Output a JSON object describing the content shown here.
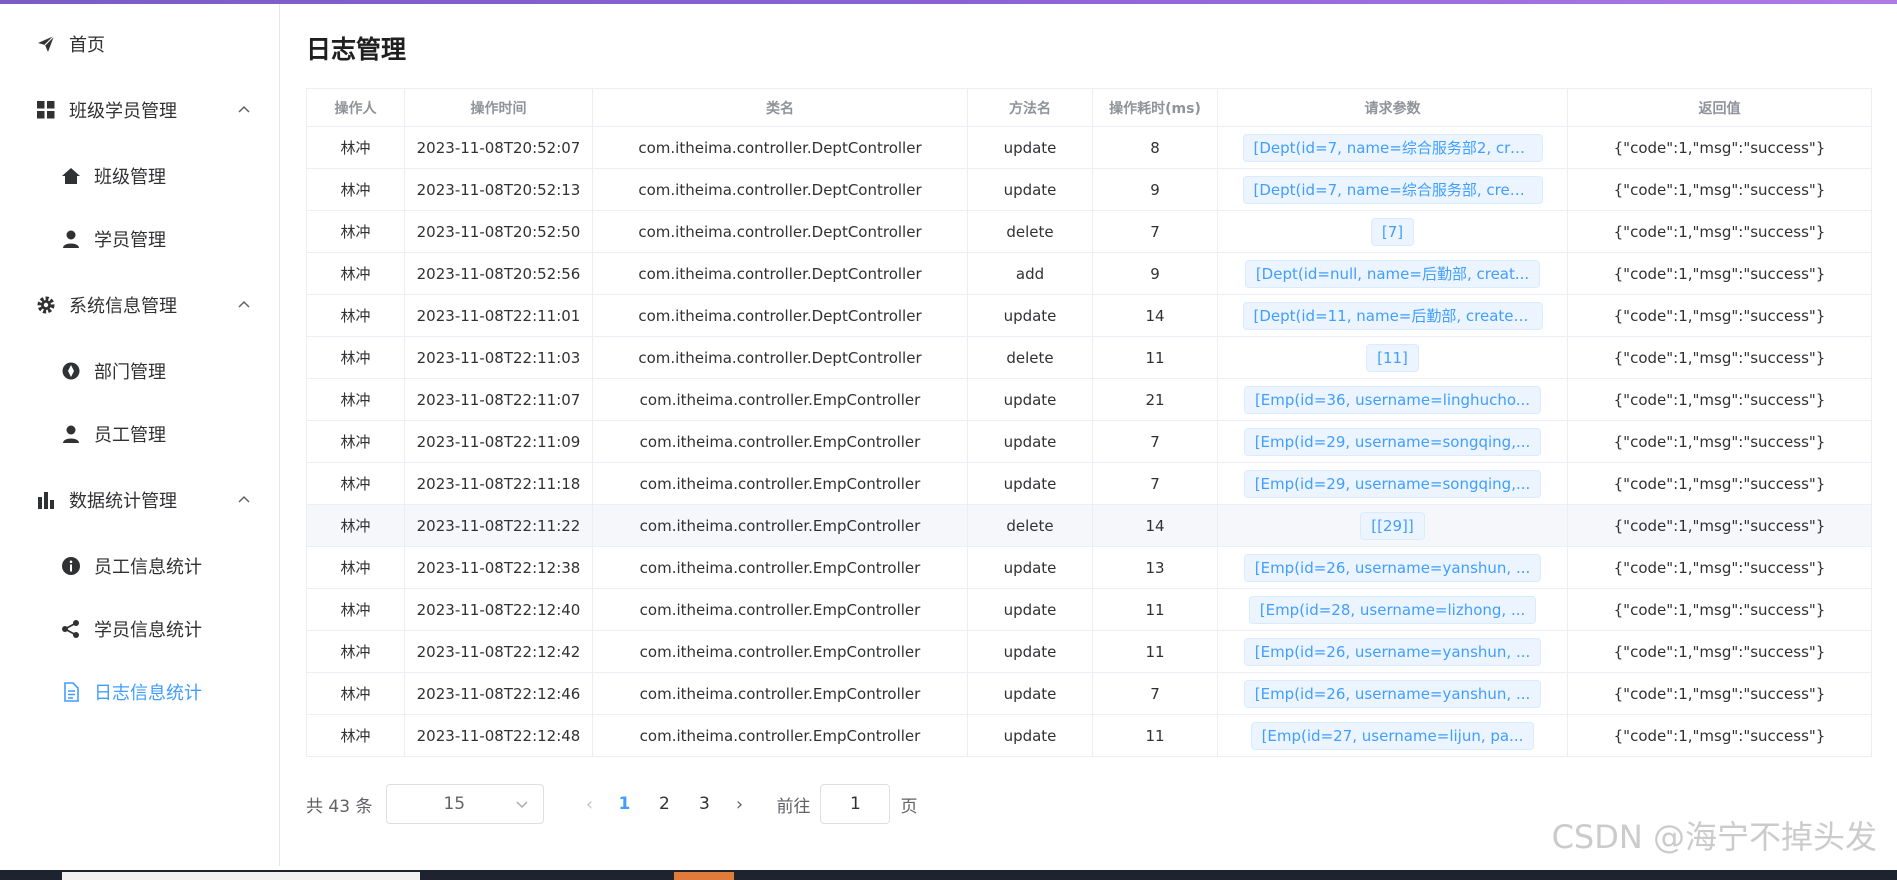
{
  "sidebar": {
    "items": [
      {
        "label": "首页",
        "icon": "paper-plane-icon"
      },
      {
        "label": "班级学员管理",
        "icon": "grid-icon"
      },
      {
        "label": "班级管理",
        "icon": "home-icon"
      },
      {
        "label": "学员管理",
        "icon": "user-icon"
      },
      {
        "label": "系统信息管理",
        "icon": "gear-icon"
      },
      {
        "label": "部门管理",
        "icon": "aperture-icon"
      },
      {
        "label": "员工管理",
        "icon": "user-icon"
      },
      {
        "label": "数据统计管理",
        "icon": "bar-chart-icon"
      },
      {
        "label": "员工信息统计",
        "icon": "info-icon"
      },
      {
        "label": "学员信息统计",
        "icon": "share-icon"
      },
      {
        "label": "日志信息统计",
        "icon": "document-icon"
      }
    ],
    "active_color": "#409eff"
  },
  "page": {
    "title": "日志管理"
  },
  "table": {
    "headers": [
      "操作人",
      "操作时间",
      "类名",
      "方法名",
      "操作耗时(ms)",
      "请求参数",
      "返回值"
    ],
    "rows": [
      [
        "林冲",
        "2023-11-08T20:52:07",
        "com.itheima.controller.DeptController",
        "update",
        "8",
        "[Dept(id=7, name=综合服务部2, creat...",
        "{\"code\":1,\"msg\":\"success\"}"
      ],
      [
        "林冲",
        "2023-11-08T20:52:13",
        "com.itheima.controller.DeptController",
        "update",
        "9",
        "[Dept(id=7, name=综合服务部, create...",
        "{\"code\":1,\"msg\":\"success\"}"
      ],
      [
        "林冲",
        "2023-11-08T20:52:50",
        "com.itheima.controller.DeptController",
        "delete",
        "7",
        "[7]",
        "{\"code\":1,\"msg\":\"success\"}"
      ],
      [
        "林冲",
        "2023-11-08T20:52:56",
        "com.itheima.controller.DeptController",
        "add",
        "9",
        "[Dept(id=null, name=后勤部, creat...",
        "{\"code\":1,\"msg\":\"success\"}"
      ],
      [
        "林冲",
        "2023-11-08T22:11:01",
        "com.itheima.controller.DeptController",
        "update",
        "14",
        "[Dept(id=11, name=后勤部, createT...",
        "{\"code\":1,\"msg\":\"success\"}"
      ],
      [
        "林冲",
        "2023-11-08T22:11:03",
        "com.itheima.controller.DeptController",
        "delete",
        "11",
        "[11]",
        "{\"code\":1,\"msg\":\"success\"}"
      ],
      [
        "林冲",
        "2023-11-08T22:11:07",
        "com.itheima.controller.EmpController",
        "update",
        "21",
        "[Emp(id=36, username=linghucho...",
        "{\"code\":1,\"msg\":\"success\"}"
      ],
      [
        "林冲",
        "2023-11-08T22:11:09",
        "com.itheima.controller.EmpController",
        "update",
        "7",
        "[Emp(id=29, username=songqing,...",
        "{\"code\":1,\"msg\":\"success\"}"
      ],
      [
        "林冲",
        "2023-11-08T22:11:18",
        "com.itheima.controller.EmpController",
        "update",
        "7",
        "[Emp(id=29, username=songqing,...",
        "{\"code\":1,\"msg\":\"success\"}"
      ],
      [
        "林冲",
        "2023-11-08T22:11:22",
        "com.itheima.controller.EmpController",
        "delete",
        "14",
        "[[29]]",
        "{\"code\":1,\"msg\":\"success\"}"
      ],
      [
        "林冲",
        "2023-11-08T22:12:38",
        "com.itheima.controller.EmpController",
        "update",
        "13",
        "[Emp(id=26, username=yanshun, ...",
        "{\"code\":1,\"msg\":\"success\"}"
      ],
      [
        "林冲",
        "2023-11-08T22:12:40",
        "com.itheima.controller.EmpController",
        "update",
        "11",
        "[Emp(id=28, username=lizhong, ...",
        "{\"code\":1,\"msg\":\"success\"}"
      ],
      [
        "林冲",
        "2023-11-08T22:12:42",
        "com.itheima.controller.EmpController",
        "update",
        "11",
        "[Emp(id=26, username=yanshun, ...",
        "{\"code\":1,\"msg\":\"success\"}"
      ],
      [
        "林冲",
        "2023-11-08T22:12:46",
        "com.itheima.controller.EmpController",
        "update",
        "7",
        "[Emp(id=26, username=yanshun, ...",
        "{\"code\":1,\"msg\":\"success\"}"
      ],
      [
        "林冲",
        "2023-11-08T22:12:48",
        "com.itheima.controller.EmpController",
        "update",
        "11",
        "[Emp(id=27, username=lijun, pa...",
        "{\"code\":1,\"msg\":\"success\"}"
      ]
    ]
  },
  "pagination": {
    "total_text": "共 43 条",
    "page_size": "15",
    "pages": [
      "1",
      "2",
      "3"
    ],
    "current_page": "1",
    "goto_prefix": "前往",
    "goto_value": "1",
    "goto_suffix": "页"
  },
  "watermark": "CSDN @海宁不掉头发"
}
